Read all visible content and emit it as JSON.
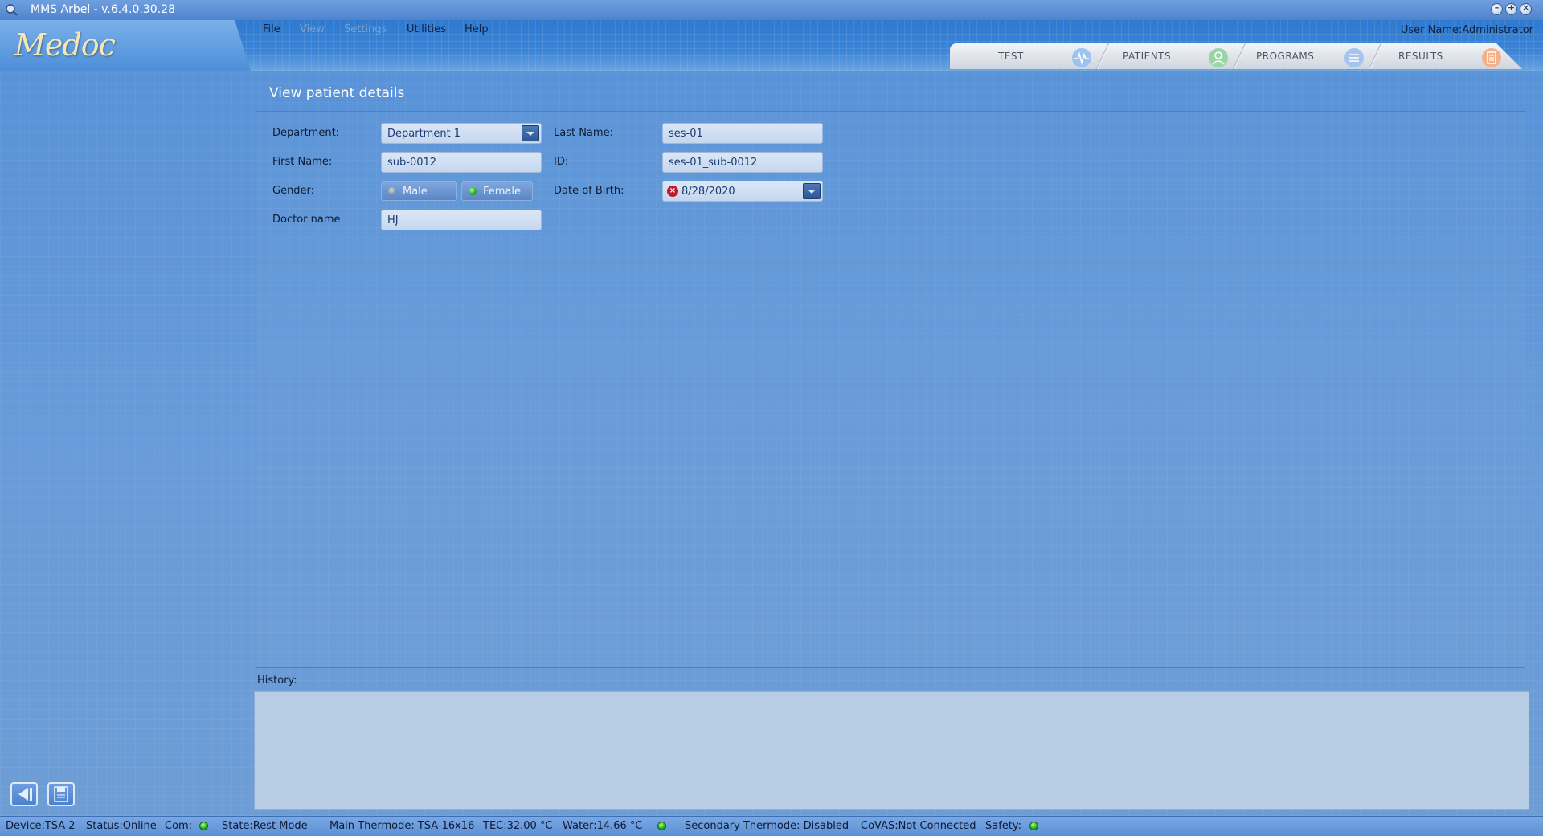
{
  "window": {
    "title": "MMS Arbel - v.6.4.0.30.28"
  },
  "header": {
    "logo": "Medoc",
    "menu": [
      {
        "label": "File",
        "enabled": true
      },
      {
        "label": "View",
        "enabled": false
      },
      {
        "label": "Settings",
        "enabled": false
      },
      {
        "label": "Utilities",
        "enabled": true
      },
      {
        "label": "Help",
        "enabled": true
      }
    ],
    "user": "User Name:Administrator"
  },
  "nav_tabs": [
    {
      "label": "TEST",
      "icon": "waveform-icon",
      "color": "#7fb0ea"
    },
    {
      "label": "PATIENTS",
      "icon": "patient-icon",
      "color": "#8ccf9a"
    },
    {
      "label": "PROGRAMS",
      "icon": "program-list-icon",
      "color": "#8fb6e6"
    },
    {
      "label": "RESULTS",
      "icon": "results-icon",
      "color": "#f0a070"
    }
  ],
  "page": {
    "title": "View patient details"
  },
  "form": {
    "department_label": "Department:",
    "department_value": "Department 1",
    "last_name_label": "Last Name:",
    "last_name_value": "ses-01",
    "first_name_label": "First Name:",
    "first_name_value": "sub-0012",
    "id_label": "ID:",
    "id_value": "ses-01_sub-0012",
    "gender_label": "Gender:",
    "gender_male": "Male",
    "gender_female": "Female",
    "gender_selected": "Female",
    "dob_label": "Date of Birth:",
    "dob_value": "8/28/2020",
    "doctor_label": "Doctor name",
    "doctor_value": "HJ"
  },
  "history": {
    "label": "History:"
  },
  "statusbar": {
    "device": "Device:TSA 2",
    "status": "Status:Online",
    "com": "Com:",
    "state": "State:Rest Mode",
    "main_thermode": "Main Thermode: TSA-16x16",
    "tec": "TEC:32.00 °C",
    "water": "Water:14.66 °C",
    "secondary": "Secondary Thermode: Disabled",
    "covas": "CoVAS:Not Connected",
    "safety": "Safety:"
  }
}
